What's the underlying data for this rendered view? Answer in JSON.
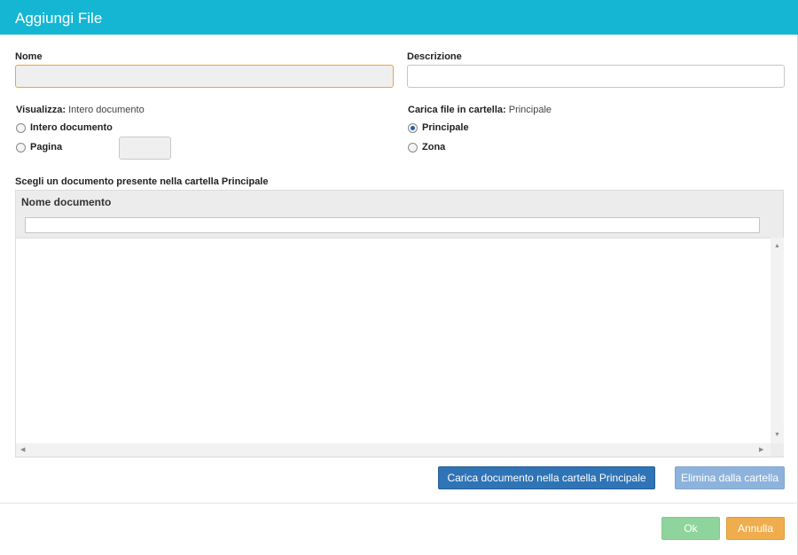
{
  "dialog": {
    "title": "Aggiungi File"
  },
  "form": {
    "name_label": "Nome",
    "name_value": "",
    "description_label": "Descrizione",
    "description_value": ""
  },
  "view": {
    "label": "Visualizza:",
    "current": "Intero documento",
    "options": [
      {
        "label": "Intero documento",
        "checked": false
      },
      {
        "label": "Pagina",
        "checked": false
      }
    ],
    "page_value": ""
  },
  "upload": {
    "label": "Carica file in cartella:",
    "current": "Principale",
    "options": [
      {
        "label": "Principale",
        "checked": true
      },
      {
        "label": "Zona",
        "checked": false
      }
    ]
  },
  "documents": {
    "section_label": "Scegli un documento presente nella cartella Principale",
    "column_header": "Nome documento",
    "filter_value": "",
    "rows": []
  },
  "actions": {
    "upload_button": "Carica documento nella cartella Principale",
    "remove_button": "Elimina dalla cartella",
    "ok_button": "Ok",
    "cancel_button": "Annulla"
  },
  "colors": {
    "title_bar": "#14b6d4",
    "primary": "#2f74b6",
    "ok": "#8fd49c",
    "cancel": "#f0ad4e"
  }
}
